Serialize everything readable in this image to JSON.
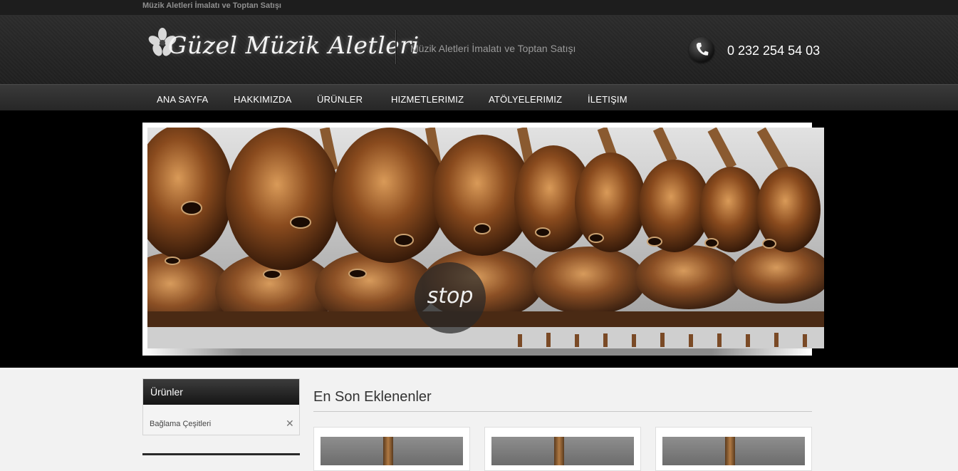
{
  "topbar": {
    "slogan": "Müzik Aletleri İmalatı ve Toptan Satışı"
  },
  "header": {
    "brand": "Güzel Müzik Aletleri",
    "tagline": "Müzik Aletleri İmalatı ve Toptan Satışı",
    "phone_icon": "phone-icon",
    "phone": "0 232 254 54 03"
  },
  "nav": {
    "items": [
      {
        "label": "ANA SAYFA"
      },
      {
        "label": "HAKKIMIZDA"
      },
      {
        "label": "ÜRÜNLER"
      },
      {
        "label": "HIZMETLERIMIZ"
      },
      {
        "label": "ATÖLYELERIMIZ"
      },
      {
        "label": "İLETIŞIM"
      }
    ]
  },
  "slider": {
    "control_label": "stop"
  },
  "sidebar": {
    "title": "Ürünler",
    "items": [
      {
        "label": "Bağlama Çeşitleri",
        "icon": "close-icon"
      }
    ]
  },
  "main": {
    "section_title": "En Son Eklenenler"
  },
  "colors": {
    "header_bg": "#222222",
    "nav_bg": "#2e2e2e",
    "page_bg": "#f2f2f2"
  }
}
